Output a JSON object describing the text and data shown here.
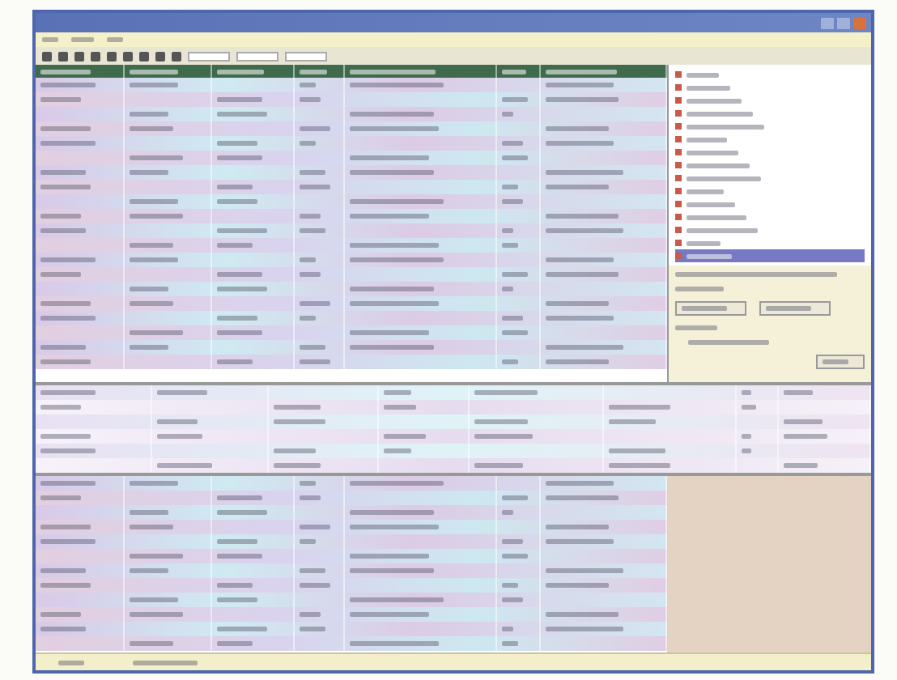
{
  "main_table": {
    "rows": [
      {
        "selected": false
      },
      {
        "selected": false
      },
      {
        "selected": false
      },
      {
        "selected": false
      },
      {
        "selected": false
      },
      {
        "selected": false
      },
      {
        "selected": false
      },
      {
        "selected": false
      },
      {
        "selected": false
      },
      {
        "selected": false
      },
      {
        "selected": false
      },
      {
        "selected": false
      },
      {
        "selected": false
      },
      {
        "selected": false
      },
      {
        "selected": false
      },
      {
        "selected": false
      },
      {
        "selected": false
      },
      {
        "selected": false
      },
      {
        "selected": false
      },
      {
        "selected": false
      }
    ]
  },
  "overlay_table": {
    "rows": [
      {
        "selected": false
      },
      {
        "selected": false
      },
      {
        "selected": false
      },
      {
        "selected": false
      },
      {
        "selected": false
      },
      {
        "selected": false
      }
    ]
  },
  "lower_table": {
    "rows": [
      {
        "selected": false
      },
      {
        "selected": false
      },
      {
        "selected": false
      },
      {
        "selected": false
      },
      {
        "selected": false
      },
      {
        "selected": false
      },
      {
        "selected": false
      },
      {
        "selected": false
      },
      {
        "selected": false
      },
      {
        "selected": false
      },
      {
        "selected": false
      },
      {
        "selected": false
      }
    ]
  },
  "side_list": {
    "items": [
      {
        "selected": false
      },
      {
        "selected": false
      },
      {
        "selected": false
      },
      {
        "selected": false
      },
      {
        "selected": false
      },
      {
        "selected": false
      },
      {
        "selected": false
      },
      {
        "selected": false
      },
      {
        "selected": false
      },
      {
        "selected": false
      },
      {
        "selected": false
      },
      {
        "selected": false
      },
      {
        "selected": false
      },
      {
        "selected": false
      },
      {
        "selected": true
      }
    ]
  }
}
